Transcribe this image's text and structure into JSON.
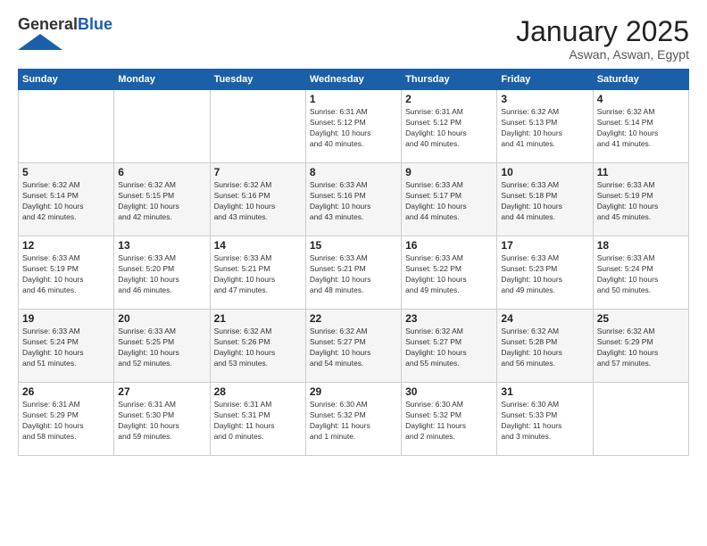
{
  "header": {
    "logo_general": "General",
    "logo_blue": "Blue",
    "month_title": "January 2025",
    "location": "Aswan, Aswan, Egypt"
  },
  "weekdays": [
    "Sunday",
    "Monday",
    "Tuesday",
    "Wednesday",
    "Thursday",
    "Friday",
    "Saturday"
  ],
  "weeks": [
    [
      {
        "day": "",
        "info": ""
      },
      {
        "day": "",
        "info": ""
      },
      {
        "day": "",
        "info": ""
      },
      {
        "day": "1",
        "info": "Sunrise: 6:31 AM\nSunset: 5:12 PM\nDaylight: 10 hours\nand 40 minutes."
      },
      {
        "day": "2",
        "info": "Sunrise: 6:31 AM\nSunset: 5:12 PM\nDaylight: 10 hours\nand 40 minutes."
      },
      {
        "day": "3",
        "info": "Sunrise: 6:32 AM\nSunset: 5:13 PM\nDaylight: 10 hours\nand 41 minutes."
      },
      {
        "day": "4",
        "info": "Sunrise: 6:32 AM\nSunset: 5:14 PM\nDaylight: 10 hours\nand 41 minutes."
      }
    ],
    [
      {
        "day": "5",
        "info": "Sunrise: 6:32 AM\nSunset: 5:14 PM\nDaylight: 10 hours\nand 42 minutes."
      },
      {
        "day": "6",
        "info": "Sunrise: 6:32 AM\nSunset: 5:15 PM\nDaylight: 10 hours\nand 42 minutes."
      },
      {
        "day": "7",
        "info": "Sunrise: 6:32 AM\nSunset: 5:16 PM\nDaylight: 10 hours\nand 43 minutes."
      },
      {
        "day": "8",
        "info": "Sunrise: 6:33 AM\nSunset: 5:16 PM\nDaylight: 10 hours\nand 43 minutes."
      },
      {
        "day": "9",
        "info": "Sunrise: 6:33 AM\nSunset: 5:17 PM\nDaylight: 10 hours\nand 44 minutes."
      },
      {
        "day": "10",
        "info": "Sunrise: 6:33 AM\nSunset: 5:18 PM\nDaylight: 10 hours\nand 44 minutes."
      },
      {
        "day": "11",
        "info": "Sunrise: 6:33 AM\nSunset: 5:19 PM\nDaylight: 10 hours\nand 45 minutes."
      }
    ],
    [
      {
        "day": "12",
        "info": "Sunrise: 6:33 AM\nSunset: 5:19 PM\nDaylight: 10 hours\nand 46 minutes."
      },
      {
        "day": "13",
        "info": "Sunrise: 6:33 AM\nSunset: 5:20 PM\nDaylight: 10 hours\nand 46 minutes."
      },
      {
        "day": "14",
        "info": "Sunrise: 6:33 AM\nSunset: 5:21 PM\nDaylight: 10 hours\nand 47 minutes."
      },
      {
        "day": "15",
        "info": "Sunrise: 6:33 AM\nSunset: 5:21 PM\nDaylight: 10 hours\nand 48 minutes."
      },
      {
        "day": "16",
        "info": "Sunrise: 6:33 AM\nSunset: 5:22 PM\nDaylight: 10 hours\nand 49 minutes."
      },
      {
        "day": "17",
        "info": "Sunrise: 6:33 AM\nSunset: 5:23 PM\nDaylight: 10 hours\nand 49 minutes."
      },
      {
        "day": "18",
        "info": "Sunrise: 6:33 AM\nSunset: 5:24 PM\nDaylight: 10 hours\nand 50 minutes."
      }
    ],
    [
      {
        "day": "19",
        "info": "Sunrise: 6:33 AM\nSunset: 5:24 PM\nDaylight: 10 hours\nand 51 minutes."
      },
      {
        "day": "20",
        "info": "Sunrise: 6:33 AM\nSunset: 5:25 PM\nDaylight: 10 hours\nand 52 minutes."
      },
      {
        "day": "21",
        "info": "Sunrise: 6:32 AM\nSunset: 5:26 PM\nDaylight: 10 hours\nand 53 minutes."
      },
      {
        "day": "22",
        "info": "Sunrise: 6:32 AM\nSunset: 5:27 PM\nDaylight: 10 hours\nand 54 minutes."
      },
      {
        "day": "23",
        "info": "Sunrise: 6:32 AM\nSunset: 5:27 PM\nDaylight: 10 hours\nand 55 minutes."
      },
      {
        "day": "24",
        "info": "Sunrise: 6:32 AM\nSunset: 5:28 PM\nDaylight: 10 hours\nand 56 minutes."
      },
      {
        "day": "25",
        "info": "Sunrise: 6:32 AM\nSunset: 5:29 PM\nDaylight: 10 hours\nand 57 minutes."
      }
    ],
    [
      {
        "day": "26",
        "info": "Sunrise: 6:31 AM\nSunset: 5:29 PM\nDaylight: 10 hours\nand 58 minutes."
      },
      {
        "day": "27",
        "info": "Sunrise: 6:31 AM\nSunset: 5:30 PM\nDaylight: 10 hours\nand 59 minutes."
      },
      {
        "day": "28",
        "info": "Sunrise: 6:31 AM\nSunset: 5:31 PM\nDaylight: 11 hours\nand 0 minutes."
      },
      {
        "day": "29",
        "info": "Sunrise: 6:30 AM\nSunset: 5:32 PM\nDaylight: 11 hours\nand 1 minute."
      },
      {
        "day": "30",
        "info": "Sunrise: 6:30 AM\nSunset: 5:32 PM\nDaylight: 11 hours\nand 2 minutes."
      },
      {
        "day": "31",
        "info": "Sunrise: 6:30 AM\nSunset: 5:33 PM\nDaylight: 11 hours\nand 3 minutes."
      },
      {
        "day": "",
        "info": ""
      }
    ]
  ]
}
